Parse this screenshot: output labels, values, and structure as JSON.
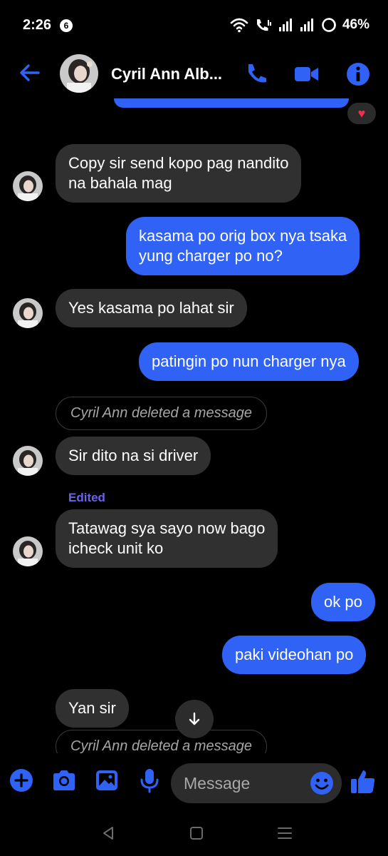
{
  "status_bar": {
    "time": "2:26",
    "notification_count": "6",
    "battery": "46%"
  },
  "header": {
    "contact_name": "Cyril Ann Alb...",
    "accent_color": "#2f62f5"
  },
  "messages": [
    {
      "type": "incoming",
      "text": "Copy sir send kopo pag nandito\nna bahala mag"
    },
    {
      "type": "outgoing",
      "text": "kasama po orig box nya tsaka\nyung charger po no?"
    },
    {
      "type": "incoming",
      "text": "Yes kasama po lahat sir"
    },
    {
      "type": "outgoing",
      "text": "patingin po nun charger nya"
    },
    {
      "type": "deleted",
      "text": "Cyril Ann deleted a message"
    },
    {
      "type": "incoming",
      "text": "Sir dito na si driver"
    },
    {
      "type": "edited_label",
      "text": "Edited"
    },
    {
      "type": "incoming",
      "text": "Tatawag sya sayo now bago\nicheck unit ko"
    },
    {
      "type": "outgoing",
      "text": "ok po"
    },
    {
      "type": "outgoing",
      "text": "paki videohan po"
    },
    {
      "type": "incoming",
      "text": "Yan sir"
    },
    {
      "type": "deleted",
      "text": "Cyril Ann deleted a message"
    }
  ],
  "reaction": {
    "icon": "heart-icon",
    "color": "#f0304a"
  },
  "composer": {
    "placeholder": "Message",
    "icons": [
      "plus-icon",
      "camera-icon",
      "image-icon",
      "microphone-icon",
      "emoji-icon",
      "thumbs-up-icon"
    ]
  },
  "colors": {
    "outgoing_bubble": "#2f62f5",
    "incoming_bubble": "#303030",
    "edited_label": "#6c63e8"
  }
}
